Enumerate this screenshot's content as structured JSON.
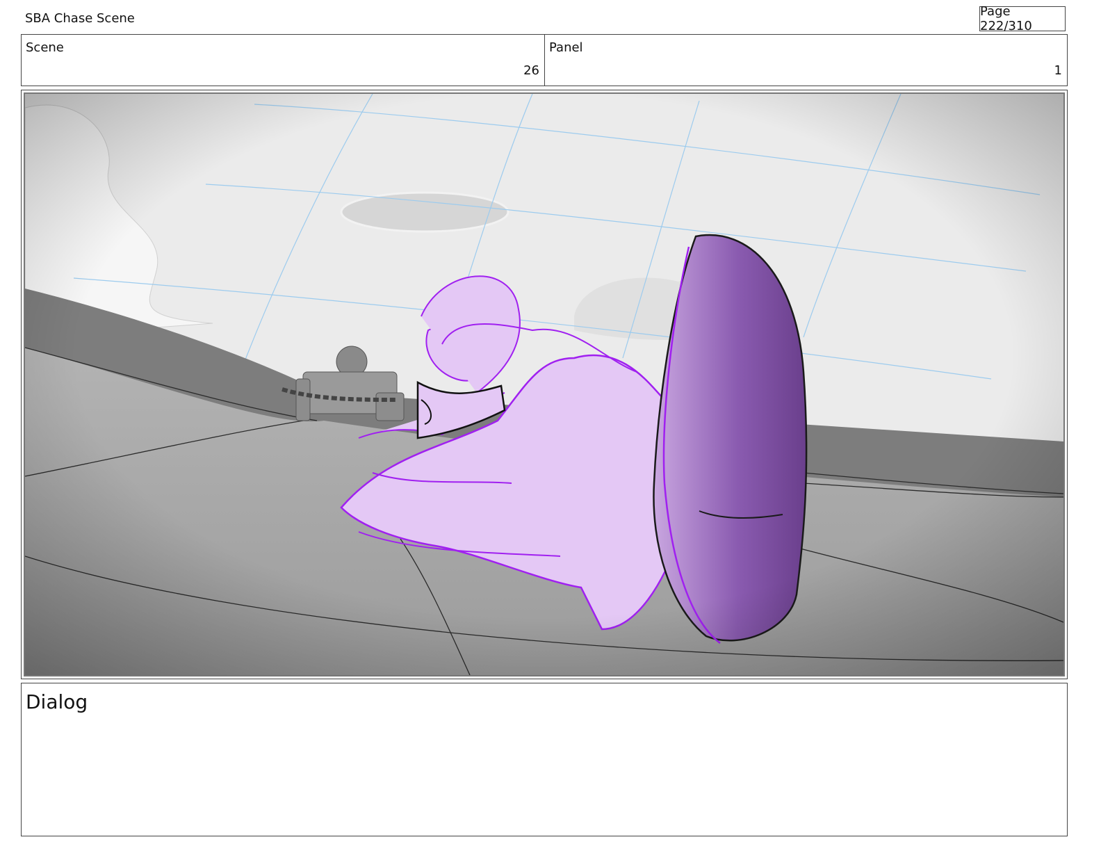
{
  "header": {
    "title": "SBA Chase Scene",
    "page": "Page 222/310"
  },
  "meta": {
    "scene_label": "Scene",
    "scene_value": "26",
    "panel_label": "Panel",
    "panel_value": "1"
  },
  "dialog": {
    "label": "Dialog"
  },
  "colors": {
    "sky": "#e9e9e9",
    "floor": "#a9a9a9",
    "wall": "#7a7a7a",
    "character_fill": "#e4c8f5",
    "character_line": "#a020f0",
    "shoe": "#7a4a9a",
    "grid_line": "#8ec5ea"
  }
}
